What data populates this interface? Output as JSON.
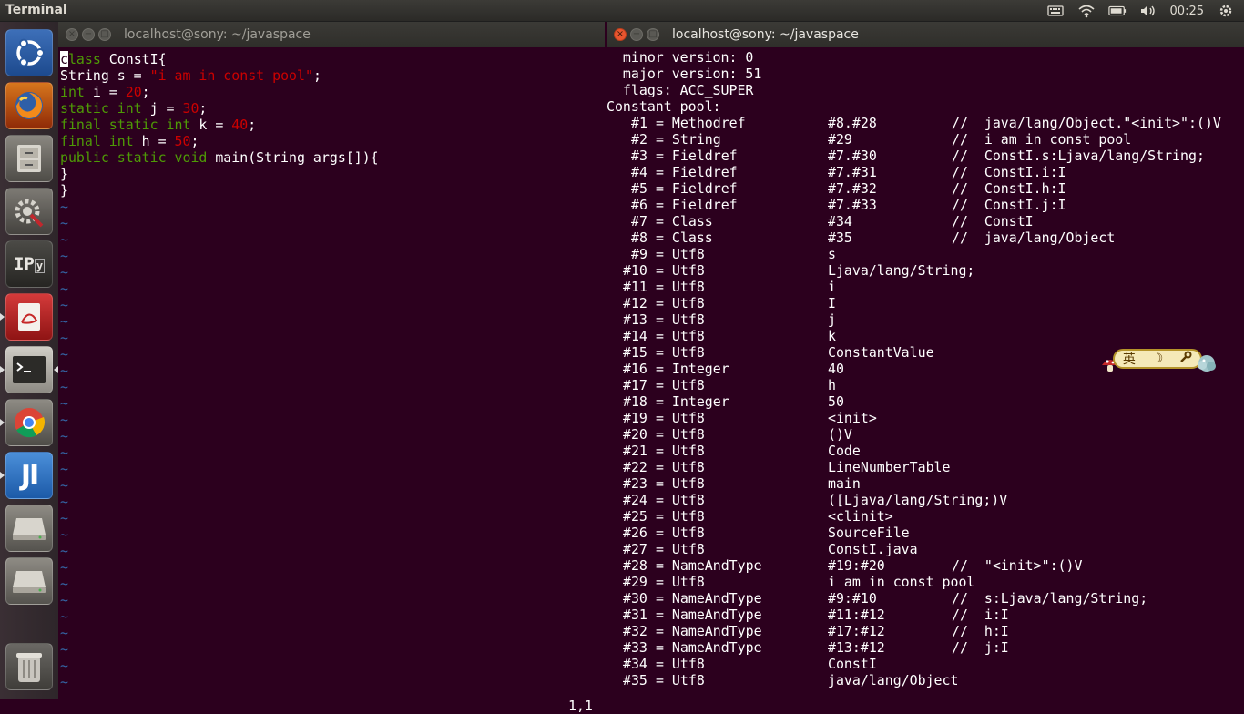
{
  "topbar": {
    "app_title": "Terminal",
    "clock": "00:25",
    "tray_icons": [
      "keyboard-icon",
      "wifi-icon",
      "battery-icon",
      "volume-icon"
    ]
  },
  "launcher": {
    "items": [
      "ubuntu-dash",
      "firefox",
      "file-manager",
      "system-settings",
      "ipython-notebook",
      "pdf-viewer",
      "terminal",
      "chrome",
      "intellij-idea",
      "disk-drive",
      "disk-drive",
      "trash"
    ]
  },
  "left_window": {
    "title": "localhost@sony: ~/javaspace",
    "ruler": "1,1",
    "code": [
      [
        {
          "t": "c",
          "c": "cursor"
        },
        {
          "t": "lass",
          "c": "kw"
        },
        {
          "t": " ConstI{",
          "c": ""
        }
      ],
      [
        {
          "t": "String s = ",
          "c": ""
        },
        {
          "t": "\"i am in const pool\"",
          "c": "str"
        },
        {
          "t": ";",
          "c": ""
        }
      ],
      [
        {
          "t": "int",
          "c": "kw"
        },
        {
          "t": " i = ",
          "c": ""
        },
        {
          "t": "20",
          "c": "num"
        },
        {
          "t": ";",
          "c": ""
        }
      ],
      [
        {
          "t": "static int",
          "c": "kw"
        },
        {
          "t": " j = ",
          "c": ""
        },
        {
          "t": "30",
          "c": "num"
        },
        {
          "t": ";",
          "c": ""
        }
      ],
      [
        {
          "t": "final static int",
          "c": "kw"
        },
        {
          "t": " k = ",
          "c": ""
        },
        {
          "t": "40",
          "c": "num"
        },
        {
          "t": ";",
          "c": ""
        }
      ],
      [
        {
          "t": "final int",
          "c": "kw"
        },
        {
          "t": " h = ",
          "c": ""
        },
        {
          "t": "50",
          "c": "num"
        },
        {
          "t": ";",
          "c": ""
        }
      ],
      [
        {
          "t": "public static void",
          "c": "kw"
        },
        {
          "t": " main(String args[]){",
          "c": ""
        }
      ],
      [
        {
          "t": "}",
          "c": ""
        }
      ],
      [
        {
          "t": "}",
          "c": ""
        }
      ]
    ],
    "tilde_count": 30
  },
  "right_window": {
    "title": "localhost@sony: ~/javaspace",
    "header_lines": [
      "  minor version: 0",
      "  major version: 51",
      "  flags: ACC_SUPER",
      "Constant pool:"
    ],
    "constant_pool": [
      {
        "num": "#1",
        "type": "Methodref",
        "ref": "#8.#28",
        "comment": "//  java/lang/Object.\"<init>\":()V"
      },
      {
        "num": "#2",
        "type": "String",
        "ref": "#29",
        "comment": "//  i am in const pool"
      },
      {
        "num": "#3",
        "type": "Fieldref",
        "ref": "#7.#30",
        "comment": "//  ConstI.s:Ljava/lang/String;"
      },
      {
        "num": "#4",
        "type": "Fieldref",
        "ref": "#7.#31",
        "comment": "//  ConstI.i:I"
      },
      {
        "num": "#5",
        "type": "Fieldref",
        "ref": "#7.#32",
        "comment": "//  ConstI.h:I"
      },
      {
        "num": "#6",
        "type": "Fieldref",
        "ref": "#7.#33",
        "comment": "//  ConstI.j:I"
      },
      {
        "num": "#7",
        "type": "Class",
        "ref": "#34",
        "comment": "//  ConstI"
      },
      {
        "num": "#8",
        "type": "Class",
        "ref": "#35",
        "comment": "//  java/lang/Object"
      },
      {
        "num": "#9",
        "type": "Utf8",
        "ref": "s",
        "comment": ""
      },
      {
        "num": "#10",
        "type": "Utf8",
        "ref": "Ljava/lang/String;",
        "comment": ""
      },
      {
        "num": "#11",
        "type": "Utf8",
        "ref": "i",
        "comment": ""
      },
      {
        "num": "#12",
        "type": "Utf8",
        "ref": "I",
        "comment": ""
      },
      {
        "num": "#13",
        "type": "Utf8",
        "ref": "j",
        "comment": ""
      },
      {
        "num": "#14",
        "type": "Utf8",
        "ref": "k",
        "comment": ""
      },
      {
        "num": "#15",
        "type": "Utf8",
        "ref": "ConstantValue",
        "comment": ""
      },
      {
        "num": "#16",
        "type": "Integer",
        "ref": "40",
        "comment": ""
      },
      {
        "num": "#17",
        "type": "Utf8",
        "ref": "h",
        "comment": ""
      },
      {
        "num": "#18",
        "type": "Integer",
        "ref": "50",
        "comment": ""
      },
      {
        "num": "#19",
        "type": "Utf8",
        "ref": "<init>",
        "comment": ""
      },
      {
        "num": "#20",
        "type": "Utf8",
        "ref": "()V",
        "comment": ""
      },
      {
        "num": "#21",
        "type": "Utf8",
        "ref": "Code",
        "comment": ""
      },
      {
        "num": "#22",
        "type": "Utf8",
        "ref": "LineNumberTable",
        "comment": ""
      },
      {
        "num": "#23",
        "type": "Utf8",
        "ref": "main",
        "comment": ""
      },
      {
        "num": "#24",
        "type": "Utf8",
        "ref": "([Ljava/lang/String;)V",
        "comment": ""
      },
      {
        "num": "#25",
        "type": "Utf8",
        "ref": "<clinit>",
        "comment": ""
      },
      {
        "num": "#26",
        "type": "Utf8",
        "ref": "SourceFile",
        "comment": ""
      },
      {
        "num": "#27",
        "type": "Utf8",
        "ref": "ConstI.java",
        "comment": ""
      },
      {
        "num": "#28",
        "type": "NameAndType",
        "ref": "#19:#20",
        "comment": "//  \"<init>\":()V"
      },
      {
        "num": "#29",
        "type": "Utf8",
        "ref": "i am in const pool",
        "comment": ""
      },
      {
        "num": "#30",
        "type": "NameAndType",
        "ref": "#9:#10",
        "comment": "//  s:Ljava/lang/String;"
      },
      {
        "num": "#31",
        "type": "NameAndType",
        "ref": "#11:#12",
        "comment": "//  i:I"
      },
      {
        "num": "#32",
        "type": "NameAndType",
        "ref": "#17:#12",
        "comment": "//  h:I"
      },
      {
        "num": "#33",
        "type": "NameAndType",
        "ref": "#13:#12",
        "comment": "//  j:I"
      },
      {
        "num": "#34",
        "type": "Utf8",
        "ref": "ConstI",
        "comment": ""
      },
      {
        "num": "#35",
        "type": "Utf8",
        "ref": "java/lang/Object",
        "comment": ""
      }
    ]
  },
  "ime": {
    "lang": "英",
    "moon": "☽",
    "wrench": "🔧"
  },
  "colors": {
    "terminal_bg": "#2c001e",
    "keyword": "#4e9a06",
    "literal": "#cc0000",
    "tilde": "#3465a4"
  }
}
